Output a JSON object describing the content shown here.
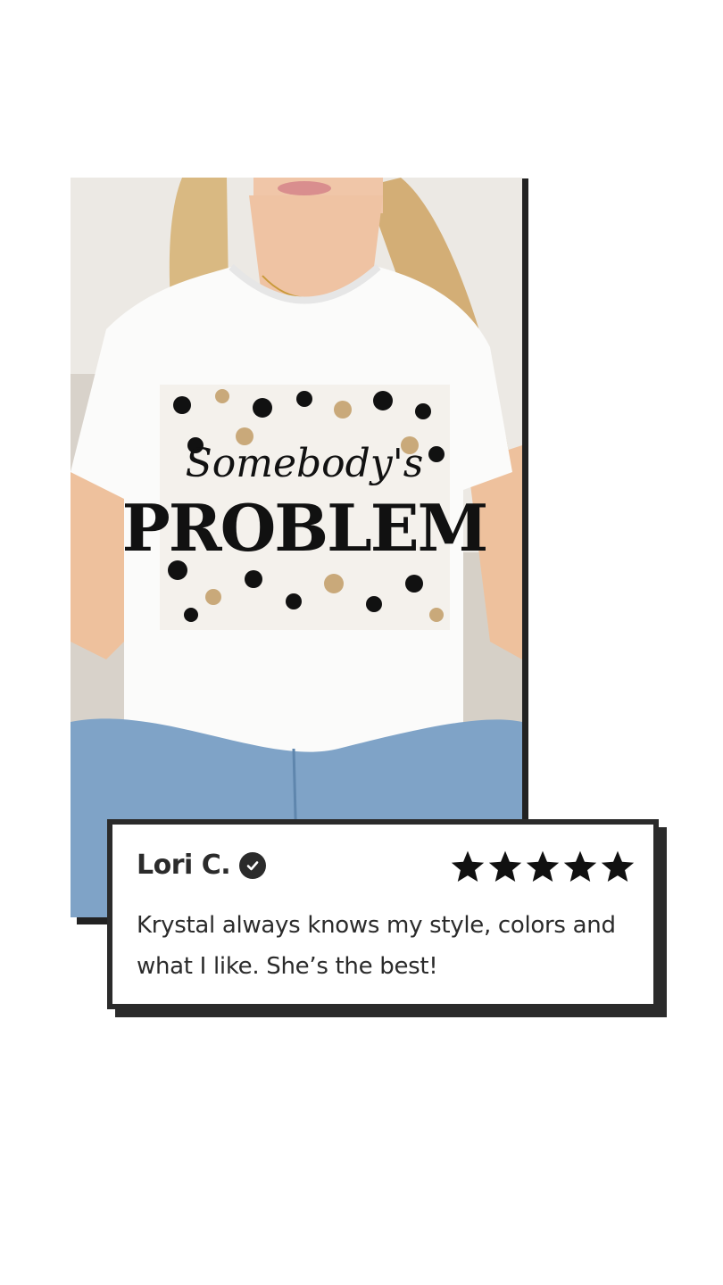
{
  "product_image": {
    "shirt_script_text": "Somebody's",
    "shirt_main_text": "PROBLEM",
    "colors": {
      "shirt": "#ffffff",
      "leopard_spot": "#111111",
      "leopard_tan": "#c9a97a",
      "denim": "#7fa3c7",
      "hair": "#d9b982"
    }
  },
  "review": {
    "reviewer_name": "Lori C.",
    "verified_icon": "check-circle-icon",
    "rating": 5,
    "rating_max": 5,
    "star_icon": "star-icon",
    "text": "Krystal always knows my style, colors and what I like. She’s the best!"
  },
  "colors": {
    "frame": "#2b2b2b",
    "background": "#ffffff"
  }
}
